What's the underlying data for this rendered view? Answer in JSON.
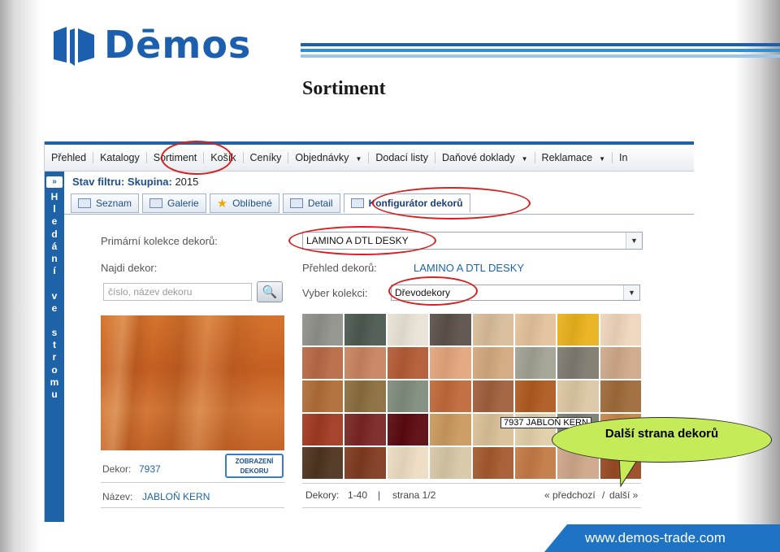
{
  "slide": {
    "logo_text": "Dēmos",
    "title": "Sortiment",
    "footer_url": "www.demos-trade.com",
    "callout": "Další strana dekorů"
  },
  "nav": {
    "items": [
      "Přehled",
      "Katalogy",
      "Sortiment",
      "Košík",
      "Ceníky",
      "Objednávky",
      "Dodací listy",
      "Daňové doklady",
      "Reklamace",
      "In"
    ],
    "dropdown_flags": [
      false,
      false,
      false,
      false,
      false,
      true,
      false,
      true,
      true,
      false
    ]
  },
  "sidebar": {
    "toggle": "»",
    "letters": [
      "H",
      "l",
      "e",
      "d",
      "á",
      "n",
      "í",
      "",
      "v",
      "e",
      "",
      "s",
      "t",
      "r",
      "o",
      "m",
      "u"
    ]
  },
  "filter": {
    "label": "Stav filtru:",
    "key": "Skupina:",
    "value": "2015"
  },
  "tabs": [
    {
      "label": "Seznam",
      "icon": "list-icon"
    },
    {
      "label": "Galerie",
      "icon": "gallery-icon"
    },
    {
      "label": "Oblíbené",
      "icon": "star-icon"
    },
    {
      "label": "Detail",
      "icon": "detail-icon"
    },
    {
      "label": "Konfigurátor dekorů",
      "icon": "configurator-icon",
      "active": true
    }
  ],
  "form": {
    "primary_label": "Primární kolekce dekorů:",
    "primary_value": "LAMINO A DTL DESKY",
    "find_label": "Najdi dekor:",
    "search_placeholder": "číslo, název dekoru",
    "overview_label": "Přehled dekorů:",
    "overview_value": "LAMINO A DTL DESKY",
    "collection_label": "Vyber kolekci:",
    "collection_value": "Dřevodekory"
  },
  "detail": {
    "button": "ZOBRAZENÍ DEKORU",
    "decor_label": "Dekor:",
    "decor_value": "7937",
    "name_label": "Název:",
    "name_value": "JABLOŇ KERN"
  },
  "swatches": {
    "colors": [
      "#8f918a",
      "#4b5a50",
      "#e9e3d6",
      "#5a514a",
      "#d8bd9a",
      "#e3c29a",
      "#e9b21c",
      "#efd5bc",
      "#b86a46",
      "#c9835f",
      "#b45b36",
      "#e3a57c",
      "#d2a87e",
      "#a3a093",
      "#7f7a6e",
      "#cfa98a",
      "#b06d38",
      "#8b6e3e",
      "#7f8c7d",
      "#c0693a",
      "#a0603d",
      "#b05a20",
      "#dcc7a3",
      "#9e6a3a",
      "#a13a22",
      "#7a2624",
      "#5a0a10",
      "#c99a5e",
      "#d9c197",
      "#e2cfa9",
      "#7a7e72",
      "#c78548",
      "#4e3420",
      "#7f3a1f",
      "#ecdcc2",
      "#d7c7a7",
      "#a45a2e",
      "#c27a44",
      "#cda78a",
      "#9a4a24"
    ],
    "tooltip": "7937 JABLOŇ KERN"
  },
  "pager": {
    "range_label": "Dekory:",
    "range": "1-40",
    "sep": "|",
    "page": "strana 1/2",
    "prev": "« předchozí",
    "slash": "/",
    "next": "další »"
  },
  "colors": {
    "brand": "#1b5fae",
    "highlight": "#d81e1e",
    "callout_bg": "#c5ec58"
  }
}
